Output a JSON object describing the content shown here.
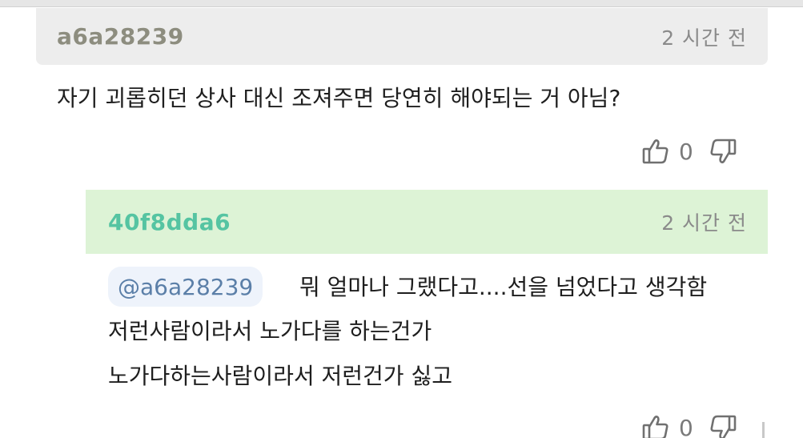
{
  "comment1": {
    "author": "a6a28239",
    "time": "2 시간 전",
    "text": "자기 괴롭히던 상사 대신 조져주면 당연히 해야되는 거 아님?",
    "likes": "0"
  },
  "comment2": {
    "author": "40f8dda6",
    "time": "2 시간 전",
    "mention": "@a6a28239",
    "line1": "뭐 얼마나 그랬다고....선을 넘었다고 생각함",
    "line2": "저런사람이라서 노가다를 하는건가",
    "line3": "노가다하는사람이라서 저런건가 싫고",
    "likes": "0"
  },
  "colors": {
    "reply_header_bg": "#ddf3d6",
    "reply_author": "#55c4a2",
    "comment_header_bg": "#ededed",
    "comment_author": "#8d8d7f",
    "mention_text": "#5b7fa8"
  },
  "icons": [
    "thumb-up-icon",
    "thumb-down-icon"
  ]
}
